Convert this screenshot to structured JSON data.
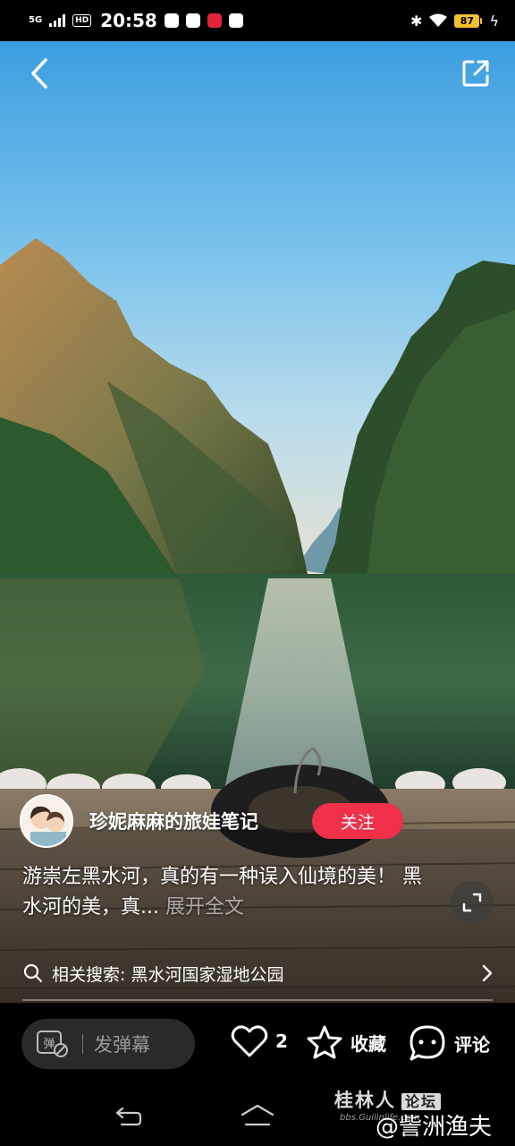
{
  "status_bar": {
    "network": "5G",
    "hd_badge": "HD",
    "time": "20:58",
    "battery": "87"
  },
  "author": {
    "name": "珍妮麻麻的旅娃笔记",
    "follow_label": "关注"
  },
  "post": {
    "description": "游崇左黑水河，真的有一种误入仙境的美！ 黑水河的美，真...",
    "expand_label": "展开全文"
  },
  "related_search": {
    "label": "相关搜索: 黑水河国家湿地公园"
  },
  "actions": {
    "danmu_icon_label": "弹",
    "danmu_placeholder": "发弹幕",
    "like_count": "2",
    "collect_label": "收藏",
    "comment_label": "评论"
  },
  "watermark": {
    "site": "桂林人",
    "forum": "论坛",
    "url": "bbs.Guilinlife.com",
    "user": "@訾洲渔夫"
  },
  "colors": {
    "follow_button": "#f1304a",
    "battery": "#f2c12e"
  },
  "icons": [
    "back-icon",
    "share-icon",
    "fullscreen-icon",
    "search-icon",
    "chevron-right-icon",
    "heart-icon",
    "star-icon",
    "comment-icon",
    "nav-back-icon",
    "nav-home-icon"
  ]
}
